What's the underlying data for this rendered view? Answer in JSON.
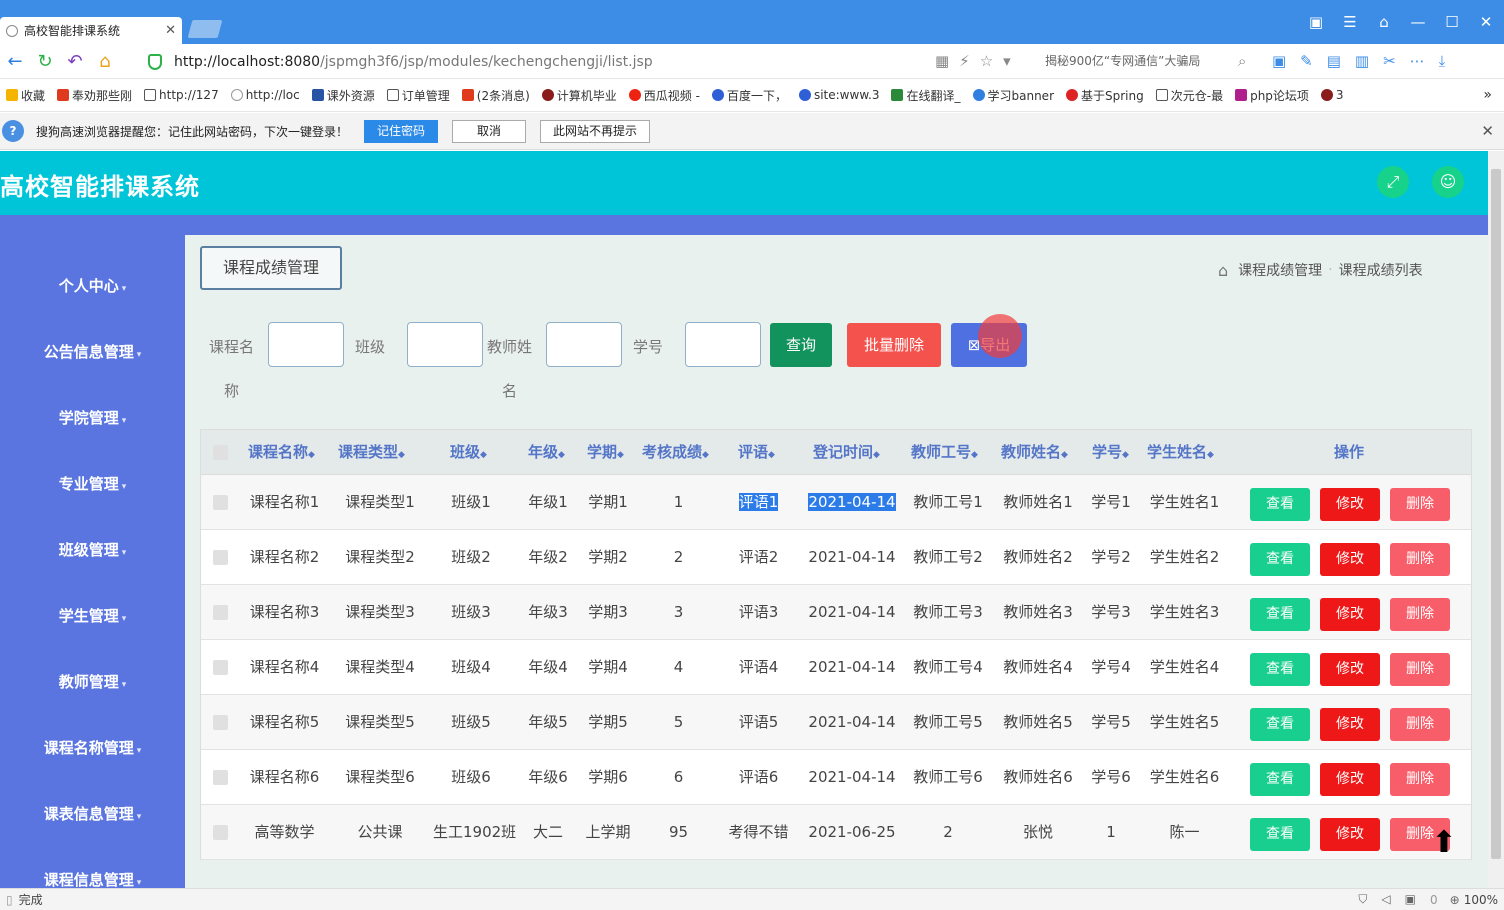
{
  "browser": {
    "tab_title": "高校智能排课系统",
    "url_host": "http://localhost:8080",
    "url_path": "/jspmgh3f6/jsp/modules/kechengchengji/list.jsp",
    "search_hint": "揭秘900亿“专网通信”大骗局",
    "bookmarks": [
      "收藏",
      "奉劝那些刚",
      "http://127",
      "http://loc",
      "课外资源",
      "订单管理",
      "(2条消息)",
      "计算机毕业",
      "西瓜视频 -",
      "百度一下，",
      "site:www.3",
      "在线翻译_",
      "学习banner",
      "基于Spring",
      "次元仓-最",
      "php论坛项",
      "3"
    ],
    "notice": {
      "text": "搜狗高速浏览器提醒您：记住此网站密码，下次一键登录！",
      "remember": "记住密码",
      "cancel": "取消",
      "never": "此网站不再提示"
    },
    "status": "完成",
    "zoom": "100%",
    "count": "0"
  },
  "app": {
    "title": "高校智能排课系统",
    "sidebar": [
      "个人中心",
      "公告信息管理",
      "学院管理",
      "专业管理",
      "班级管理",
      "学生管理",
      "教师管理",
      "课程名称管理",
      "课表信息管理",
      "课程信息管理"
    ],
    "page_title": "课程成绩管理",
    "breadcrumb": [
      "课程成绩管理",
      "课程成绩列表"
    ],
    "filters": {
      "course_label_1": "课程名",
      "course_label_2": "称",
      "class_label": "班级",
      "teacher_label_1": "教师姓",
      "teacher_label_2": "名",
      "student_label": "学号"
    },
    "actions": {
      "query": "查询",
      "batch_delete": "批量删除",
      "export": "导出"
    },
    "columns": [
      "课程名称",
      "课程类型",
      "班级",
      "年级",
      "学期",
      "考核成绩",
      "评语",
      "登记时间",
      "教师工号",
      "教师姓名",
      "学号",
      "学生姓名",
      "操作"
    ],
    "row_buttons": {
      "view": "查看",
      "edit": "修改",
      "delete": "删除"
    },
    "rows": [
      [
        "课程名称1",
        "课程类型1",
        "班级1",
        "年级1",
        "学期1",
        "1",
        "评语1",
        "2021-04-14",
        "教师工号1",
        "教师姓名1",
        "学号1",
        "学生姓名1"
      ],
      [
        "课程名称2",
        "课程类型2",
        "班级2",
        "年级2",
        "学期2",
        "2",
        "评语2",
        "2021-04-14",
        "教师工号2",
        "教师姓名2",
        "学号2",
        "学生姓名2"
      ],
      [
        "课程名称3",
        "课程类型3",
        "班级3",
        "年级3",
        "学期3",
        "3",
        "评语3",
        "2021-04-14",
        "教师工号3",
        "教师姓名3",
        "学号3",
        "学生姓名3"
      ],
      [
        "课程名称4",
        "课程类型4",
        "班级4",
        "年级4",
        "学期4",
        "4",
        "评语4",
        "2021-04-14",
        "教师工号4",
        "教师姓名4",
        "学号4",
        "学生姓名4"
      ],
      [
        "课程名称5",
        "课程类型5",
        "班级5",
        "年级5",
        "学期5",
        "5",
        "评语5",
        "2021-04-14",
        "教师工号5",
        "教师姓名5",
        "学号5",
        "学生姓名5"
      ],
      [
        "课程名称6",
        "课程类型6",
        "班级6",
        "年级6",
        "学期6",
        "6",
        "评语6",
        "2021-04-14",
        "教师工号6",
        "教师姓名6",
        "学号6",
        "学生姓名6"
      ],
      [
        "高等数学",
        "公共课",
        "生工1902班",
        "大二",
        "上学期",
        "95",
        "考得不错",
        "2021-06-25",
        "2",
        "张悦",
        "1",
        "陈一"
      ]
    ]
  },
  "colors": {
    "header": "#00c4d8",
    "sidebar": "#5a75e0",
    "view": "#18cf8f",
    "edit": "#ef1818",
    "delete": "#f85d6a",
    "query": "#12925c",
    "batch_delete": "#f4524d",
    "export": "#4f70e0"
  }
}
